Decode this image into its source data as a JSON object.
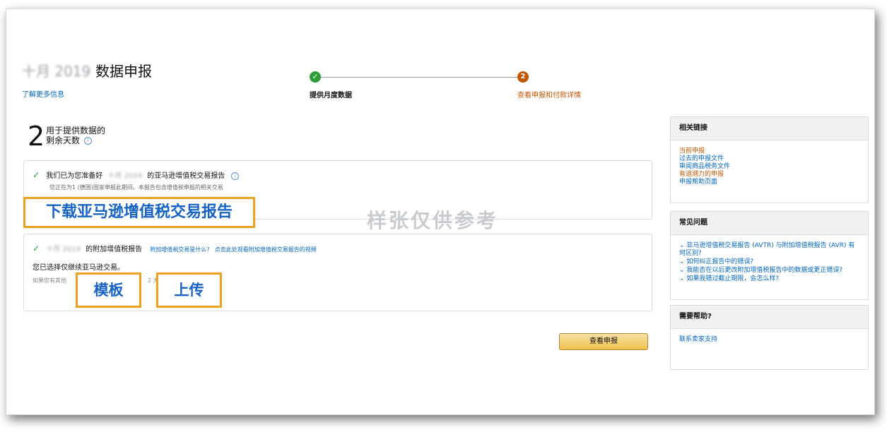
{
  "header": {
    "month": "十月 2019",
    "title": "数据申报",
    "learn_more": "了解更多信息"
  },
  "stepper": {
    "step1_icon": "check-icon",
    "step1_label": "提供月度数据",
    "step2_number": "2",
    "step2_label": "查看申报和付款详情"
  },
  "days": {
    "number": "2",
    "line1": "用于提供数据的",
    "line2": "剩余天数"
  },
  "report_box": {
    "title_prefix": "我们已为您准备好",
    "title_blurred": "十月 2019",
    "title_suffix": "的亚马逊增值税交易报告",
    "subtitle": "您正在为1 (德国)国家申报此期间。本报告包含增值税申报的相关交易"
  },
  "additional_box": {
    "title_blurred": "十月 2019",
    "title_suffix": "的附加增值税报告",
    "link1": "附加增值税交易是什么?",
    "link2": "点击此处观看附加增值税交易报告的视频",
    "selection": "您已选择仅继续亚马逊交易。",
    "hint_prefix": "如果您有其他",
    "hint_mid": "2 天内"
  },
  "overlays": {
    "download": "下载亚马逊增值税交易报告",
    "template": "模板",
    "upload": "上传",
    "watermark": "样张仅供参考"
  },
  "view_button": "查看申报",
  "sidebar": {
    "related": {
      "title": "相关链接",
      "links": [
        "当前申报",
        "过去的申报文件",
        "审阅商品税务文件",
        "有追溯力的申报",
        "申报帮助页面"
      ]
    },
    "faq": {
      "title": "常见问题",
      "items": [
        "亚马逊增值税交易报告 (AVTR) 与附加增值税报告 (AVR) 有何区别?",
        "如何纠正报告中的错误?",
        "我能否在以后更改附加增值税报告中的数据或更正错误?",
        "如果我错过截止期限，会怎么样?"
      ]
    },
    "help": {
      "title": "需要帮助?",
      "link": "联系卖家支持"
    }
  },
  "colors": {
    "link": "#0066c0",
    "accent_orange": "#c45500",
    "success_green": "#2e9c3a",
    "highlight_border": "#f0a020"
  }
}
